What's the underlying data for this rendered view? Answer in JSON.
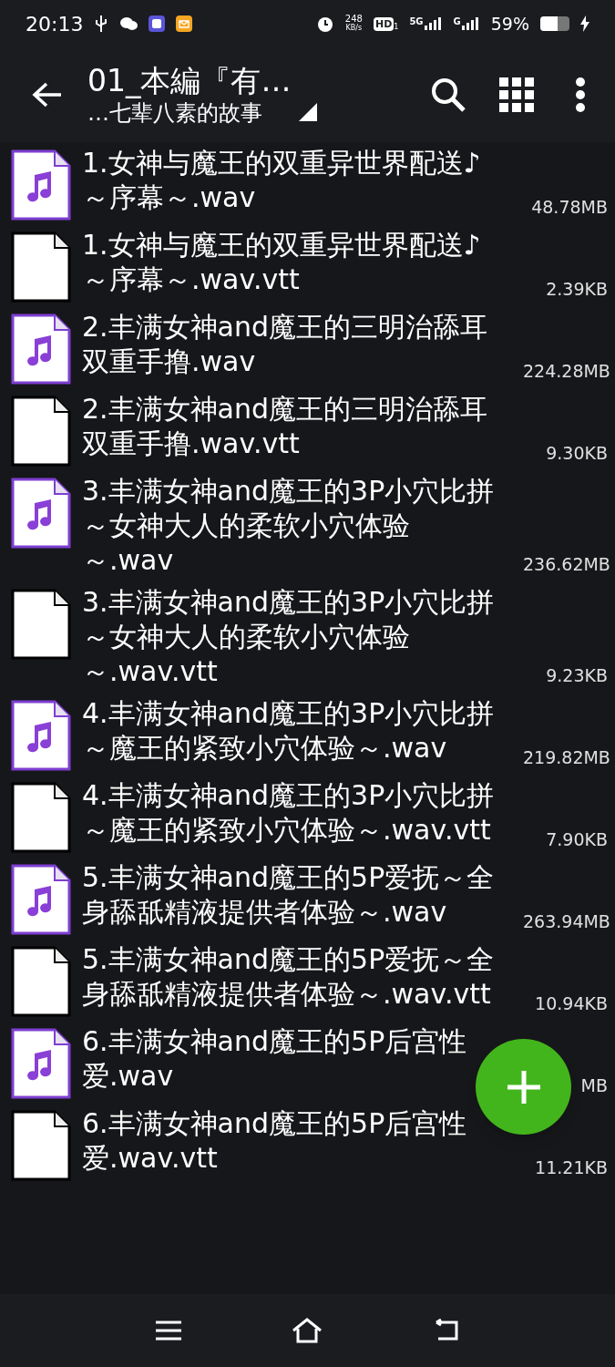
{
  "status_bar": {
    "time": "20:13",
    "net_speed_value": "248",
    "net_speed_unit": "KB/s",
    "hd_label": "HD",
    "hd_sub": "1",
    "network_5g": "5G",
    "network_g": "G",
    "battery": "59%"
  },
  "toolbar": {
    "title": "01_本編『有…",
    "subtitle": "…七辈八素的故事"
  },
  "files": [
    {
      "kind": "audio",
      "name": "1.女神与魔王的双重异世界配送♪～序幕～.wav",
      "size": "48.78MB"
    },
    {
      "kind": "text",
      "name": "1.女神与魔王的双重异世界配送♪～序幕～.wav.vtt",
      "size": "2.39KB"
    },
    {
      "kind": "audio",
      "name": "2.丰满女神and魔王的三明治舔耳双重手撸.wav",
      "size": "224.28MB"
    },
    {
      "kind": "text",
      "name": "2.丰满女神and魔王的三明治舔耳双重手撸.wav.vtt",
      "size": "9.30KB"
    },
    {
      "kind": "audio",
      "name": "3.丰满女神and魔王的3P小穴比拼～女神大人的柔软小穴体验～.wav",
      "size": "236.62MB"
    },
    {
      "kind": "text",
      "name": "3.丰满女神and魔王的3P小穴比拼～女神大人的柔软小穴体验～.wav.vtt",
      "size": "9.23KB"
    },
    {
      "kind": "audio",
      "name": "4.丰满女神and魔王的3P小穴比拼～魔王的紧致小穴体验～.wav",
      "size": "219.82MB"
    },
    {
      "kind": "text",
      "name": "4.丰满女神and魔王的3P小穴比拼～魔王的紧致小穴体验～.wav.vtt",
      "size": "7.90KB"
    },
    {
      "kind": "audio",
      "name": "5.丰满女神and魔王的5P爱抚～全身舔舐精液提供者体验～.wav",
      "size": "263.94MB"
    },
    {
      "kind": "text",
      "name": "5.丰满女神and魔王的5P爱抚～全身舔舐精液提供者体验～.wav.vtt",
      "size": "10.94KB"
    },
    {
      "kind": "audio",
      "name": "6.丰满女神and魔王的5P后宫性爱.wav",
      "size": "MB"
    },
    {
      "kind": "text",
      "name": "6.丰满女神and魔王的5P后宫性爱.wav.vtt",
      "size": "11.21KB"
    }
  ]
}
